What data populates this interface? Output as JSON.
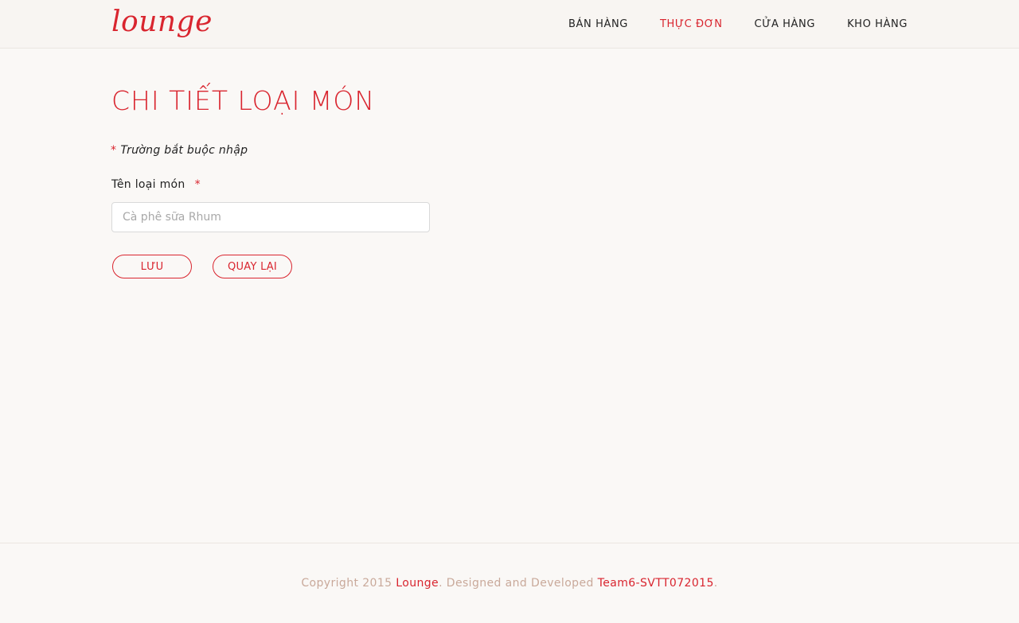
{
  "header": {
    "logo_text": "lounge",
    "nav": [
      {
        "label": "BÁN HÀNG",
        "active": false
      },
      {
        "label": "THỰC ĐƠN",
        "active": true
      },
      {
        "label": "CỬA HÀNG",
        "active": false
      },
      {
        "label": "KHO HÀNG",
        "active": false
      }
    ]
  },
  "main": {
    "title": "CHI TIẾT LOẠI MÓN",
    "required_star": "*",
    "required_note": "Trường bắt buộc nhập",
    "field_label": "Tên loại món",
    "field_star": "*",
    "field_value": "",
    "field_placeholder": "Cà phê sữa Rhum",
    "save_label": "LƯU",
    "back_label": "QUAY LẠI"
  },
  "footer": {
    "prefix": "Copyright 2015 ",
    "brand_link": "Lounge",
    "middle": ". Designed and Developed ",
    "team_link": "Team6-SVTT072015",
    "suffix": "."
  },
  "colors": {
    "accent": "#d9252f",
    "background": "#faf8f6",
    "footer_text": "#c9a99a"
  }
}
